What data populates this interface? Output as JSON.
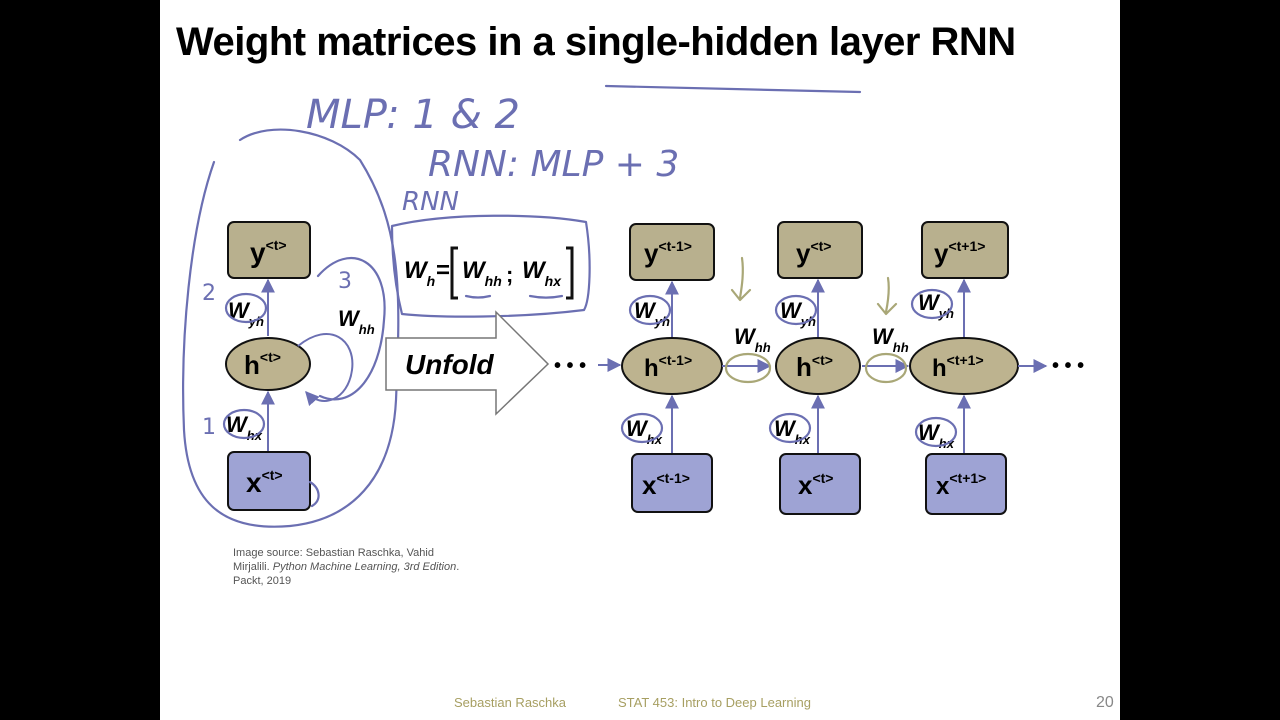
{
  "slide": {
    "title": "Weight matrices in a single-hidden layer RNN",
    "source": {
      "prefix": "Image source: Sebastian Raschka, Vahid Mirjalili. ",
      "book": "Python Machine Learning, 3rd Edition",
      "suffix": ". Packt, 2019"
    },
    "footer": {
      "author": "Sebastian Raschka",
      "course": "STAT 453: Intro to Deep Learning",
      "page": "20"
    }
  },
  "annotations": {
    "line1": "MLP: 1 & 2",
    "line2": "RNN: MLP + 3",
    "line3": "RNN",
    "n1": "1",
    "n2": "2",
    "n3": "3"
  },
  "diagram": {
    "folded": {
      "y": {
        "base": "y",
        "sup": "<t>"
      },
      "h": {
        "base": "h",
        "sup": "<t>"
      },
      "x": {
        "base": "x",
        "sup": "<t>"
      },
      "w_yh": {
        "base": "W",
        "sub": "yh"
      },
      "w_hh": {
        "base": "W",
        "sub": "hh"
      },
      "w_hx": {
        "base": "W",
        "sub": "hx"
      }
    },
    "equation": {
      "lhs": "W",
      "lhs_sub": "h",
      "eq": "=",
      "a": "W",
      "a_sub": "hh",
      "sep": ";",
      "b": "W",
      "b_sub": "hx"
    },
    "unfold_label": "Unfold",
    "dots": "• • •",
    "steps": [
      {
        "y": {
          "base": "y",
          "sup": "<t-1>"
        },
        "h": {
          "base": "h",
          "sup": "<t-1>"
        },
        "x": {
          "base": "x",
          "sup": "<t-1>"
        },
        "w_yh": {
          "base": "W",
          "sub": "yh"
        },
        "w_hx": {
          "base": "W",
          "sub": "hx"
        }
      },
      {
        "y": {
          "base": "y",
          "sup": "<t>"
        },
        "h": {
          "base": "h",
          "sup": "<t>"
        },
        "x": {
          "base": "x",
          "sup": "<t>"
        },
        "w_yh": {
          "base": "W",
          "sub": "yh"
        },
        "w_hx": {
          "base": "W",
          "sub": "hx"
        }
      },
      {
        "y": {
          "base": "y",
          "sup": "<t+1>"
        },
        "h": {
          "base": "h",
          "sup": "<t+1>"
        },
        "x": {
          "base": "x",
          "sup": "<t+1>"
        },
        "w_yh": {
          "base": "W",
          "sub": "yh"
        },
        "w_hx": {
          "base": "W",
          "sub": "hx"
        }
      }
    ],
    "recurrent": [
      {
        "base": "W",
        "sub": "hh"
      },
      {
        "base": "W",
        "sub": "hh"
      }
    ]
  },
  "colors": {
    "output_box": "#b8b08e",
    "hidden_ellipse": "#bdb38f",
    "input_box": "#9ea3d4",
    "pen_blue": "#6b6fb2",
    "pen_olive": "#a9a777",
    "footer_text": "#a79f62"
  }
}
